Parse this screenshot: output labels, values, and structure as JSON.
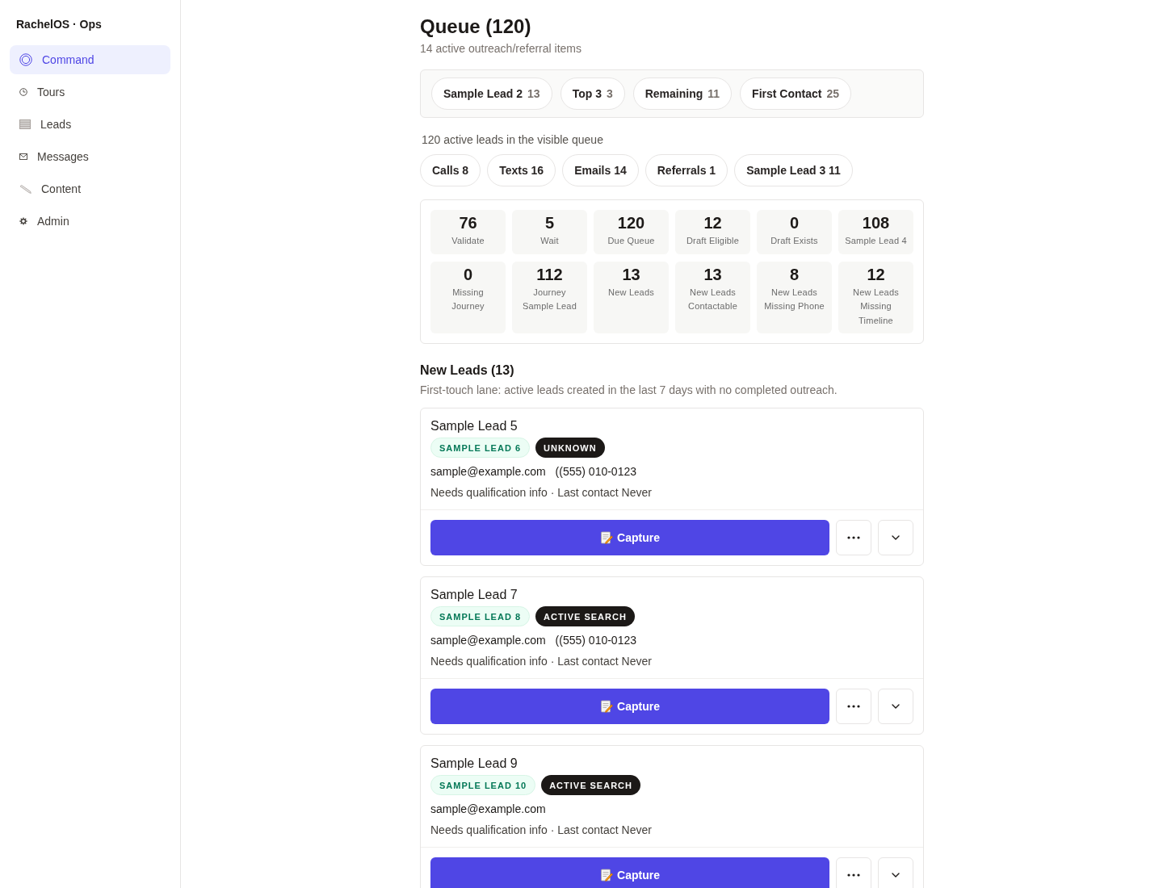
{
  "sidebar": {
    "brand": "RachelOS · Ops",
    "items": [
      {
        "label": "Command",
        "selected": true
      },
      {
        "label": "Tours",
        "selected": false
      },
      {
        "label": "Leads",
        "selected": false
      },
      {
        "label": "Messages",
        "selected": false
      },
      {
        "label": "Content",
        "selected": false
      },
      {
        "label": "Admin",
        "selected": false
      }
    ]
  },
  "header": {
    "title": "Queue (120)",
    "subtitle": "14 active outreach/referral items"
  },
  "summary_chips": [
    {
      "label": "Sample Lead 2",
      "count": "13"
    },
    {
      "label": "Top 3",
      "count": "3"
    },
    {
      "label": "Remaining",
      "count": "11"
    },
    {
      "label": "First Contact",
      "count": "25"
    }
  ],
  "queue_note": "120 active leads in the visible queue",
  "channel_chips": [
    "Calls 8",
    "Texts 16",
    "Emails 14",
    "Referrals 1",
    "Sample Lead 3 11"
  ],
  "stats": [
    {
      "value": "76",
      "label": "Validate"
    },
    {
      "value": "5",
      "label": "Wait"
    },
    {
      "value": "120",
      "label": "Due Queue"
    },
    {
      "value": "12",
      "label": "Draft Eligible"
    },
    {
      "value": "0",
      "label": "Draft Exists"
    },
    {
      "value": "108",
      "label": "Sample Lead 4"
    },
    {
      "value": "0",
      "label": "Missing Journey"
    },
    {
      "value": "112",
      "label": "Journey Sample Lead"
    },
    {
      "value": "13",
      "label": "New Leads"
    },
    {
      "value": "13",
      "label": "New Leads Contactable"
    },
    {
      "value": "8",
      "label": "New Leads Missing Phone"
    },
    {
      "value": "12",
      "label": "New Leads Missing Timeline"
    }
  ],
  "section": {
    "title": "New Leads (13)",
    "description": "First-touch lane: active leads created in the last 7 days with no completed outreach."
  },
  "leads": [
    {
      "name": "Sample Lead 5",
      "tags": [
        {
          "label": "SAMPLE LEAD 6",
          "kind": "segment"
        },
        {
          "label": "UNKNOWN",
          "kind": "status"
        }
      ],
      "email": "sample@example.com",
      "phone": "((555) 010-0123",
      "meta": "Needs qualification info · Last contact Never",
      "action": "Capture"
    },
    {
      "name": "Sample Lead 7",
      "tags": [
        {
          "label": "SAMPLE LEAD 8",
          "kind": "segment"
        },
        {
          "label": "ACTIVE SEARCH",
          "kind": "status"
        }
      ],
      "email": "sample@example.com",
      "phone": "((555) 010-0123",
      "meta": "Needs qualification info · Last contact Never",
      "action": "Capture"
    },
    {
      "name": "Sample Lead 9",
      "tags": [
        {
          "label": "SAMPLE LEAD 10",
          "kind": "segment"
        },
        {
          "label": "ACTIVE SEARCH",
          "kind": "status"
        }
      ],
      "email": "sample@example.com",
      "meta": "Needs qualification info · Last contact Never",
      "action": "Capture"
    }
  ]
}
